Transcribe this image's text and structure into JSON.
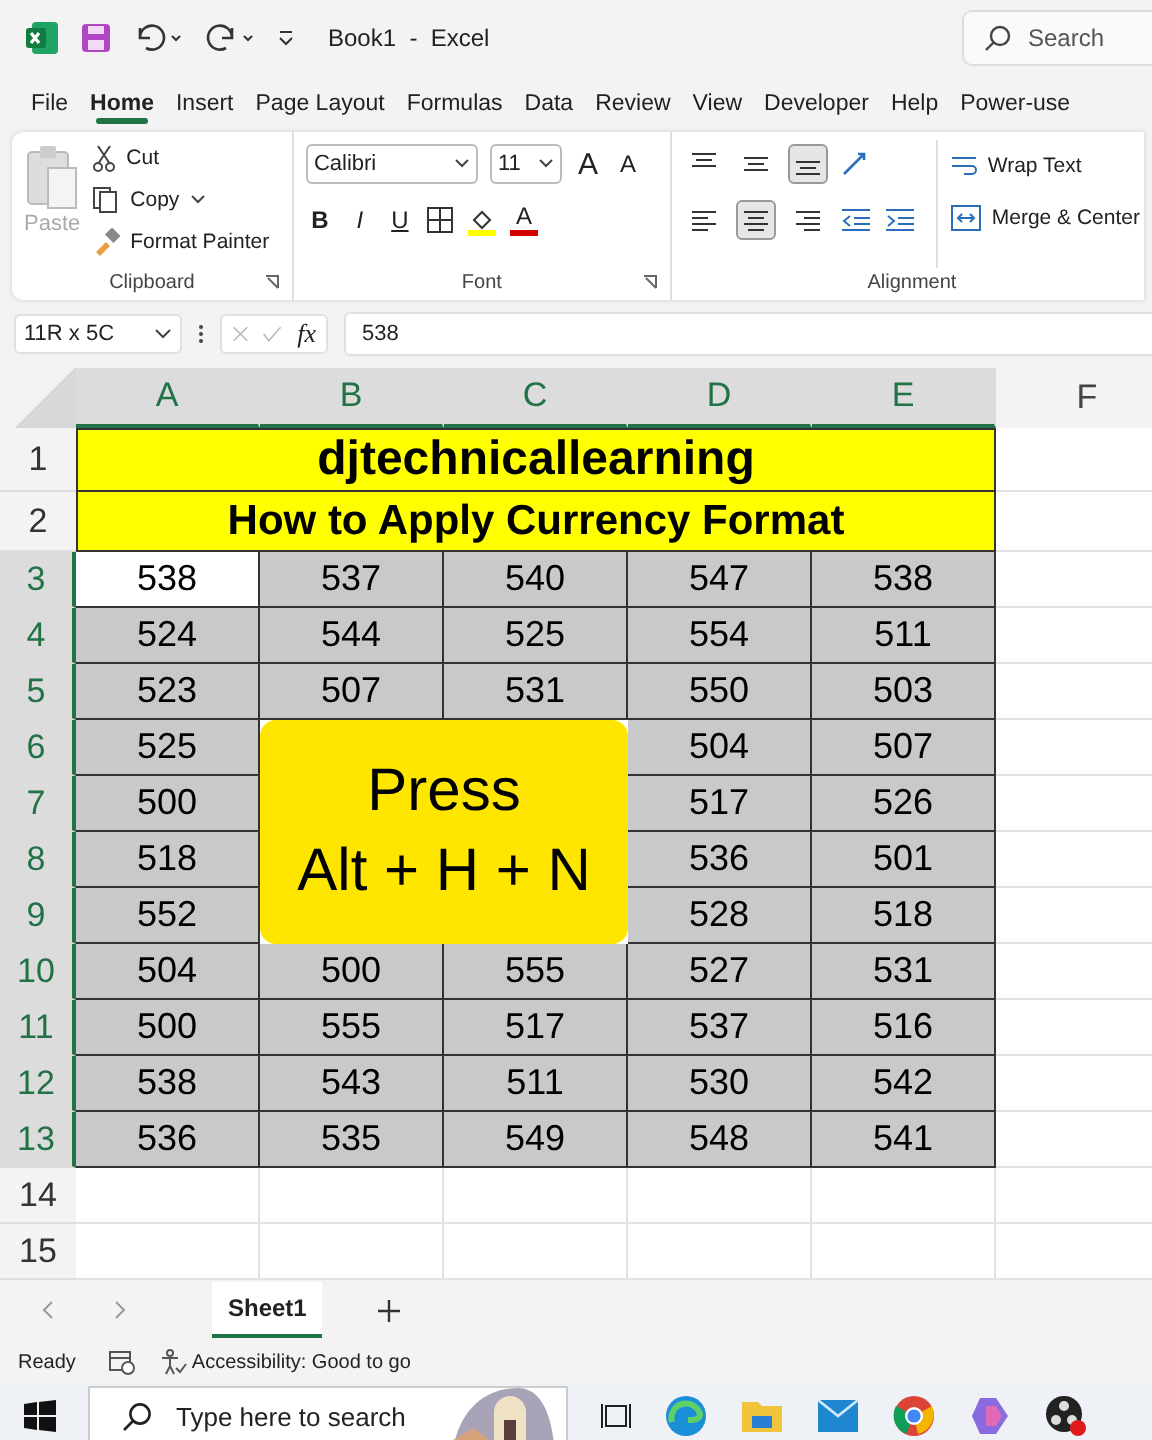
{
  "title_bar": {
    "title": "Book1  -  Excel",
    "search_placeholder": "Search"
  },
  "ribbon_tabs": [
    {
      "label": "File",
      "selected": false
    },
    {
      "label": "Home",
      "selected": true
    },
    {
      "label": "Insert",
      "selected": false
    },
    {
      "label": "Page Layout",
      "selected": false
    },
    {
      "label": "Formulas",
      "selected": false
    },
    {
      "label": "Data",
      "selected": false
    },
    {
      "label": "Review",
      "selected": false
    },
    {
      "label": "View",
      "selected": false
    },
    {
      "label": "Developer",
      "selected": false
    },
    {
      "label": "Help",
      "selected": false
    },
    {
      "label": "Power-use",
      "selected": false
    }
  ],
  "ribbon": {
    "clipboard": {
      "paste": "Paste",
      "paste_disabled": true,
      "cut": "Cut",
      "copy": "Copy",
      "format_painter": "Format Painter",
      "label": "Clipboard"
    },
    "font": {
      "font_name": "Calibri",
      "font_size": "11",
      "grow": "A",
      "shrink": "A",
      "bold": "B",
      "italic": "I",
      "underline": "U",
      "font_color": "A",
      "label": "Font"
    },
    "alignment": {
      "vertical": [
        {
          "selected": false
        },
        {
          "selected": false
        },
        {
          "selected": true
        }
      ],
      "horizontal": [
        {
          "selected": false
        },
        {
          "selected": true
        },
        {
          "selected": false
        }
      ],
      "wrap_text": "Wrap Text",
      "merge_center": "Merge & Center",
      "label": "Alignment"
    }
  },
  "formula_bar": {
    "name_box": "11R x 5C",
    "fx": "fx",
    "value": "538"
  },
  "sheet": {
    "columns": [
      {
        "label": "A",
        "selected": true
      },
      {
        "label": "B",
        "selected": true
      },
      {
        "label": "C",
        "selected": true
      },
      {
        "label": "D",
        "selected": true
      },
      {
        "label": "E",
        "selected": true
      },
      {
        "label": "F",
        "selected": false
      }
    ],
    "rows": [
      {
        "header": "1",
        "kind": "title",
        "selected": false,
        "text": "djtechnicallearning"
      },
      {
        "header": "2",
        "kind": "subtitle",
        "selected": false,
        "text": "How to Apply Currency Format"
      },
      {
        "header": "3",
        "kind": "data",
        "selected": true,
        "cells": [
          {
            "value": "538",
            "active": true
          },
          {
            "value": "537",
            "active": false
          },
          {
            "value": "540",
            "active": false
          },
          {
            "value": "547",
            "active": false
          },
          {
            "value": "538",
            "active": false
          }
        ]
      },
      {
        "header": "4",
        "kind": "data",
        "selected": true,
        "cells": [
          {
            "value": "524",
            "active": false
          },
          {
            "value": "544",
            "active": false
          },
          {
            "value": "525",
            "active": false
          },
          {
            "value": "554",
            "active": false
          },
          {
            "value": "511",
            "active": false
          }
        ]
      },
      {
        "header": "5",
        "kind": "data",
        "selected": true,
        "cells": [
          {
            "value": "523",
            "active": false
          },
          {
            "value": "507",
            "active": false
          },
          {
            "value": "531",
            "active": false
          },
          {
            "value": "550",
            "active": false
          },
          {
            "value": "503",
            "active": false
          }
        ]
      },
      {
        "header": "6",
        "kind": "data",
        "selected": true,
        "cells": [
          {
            "value": "525",
            "active": false
          },
          {},
          {},
          {
            "value": "504",
            "active": false
          },
          {
            "value": "507",
            "active": false
          }
        ]
      },
      {
        "header": "7",
        "kind": "data",
        "selected": true,
        "cells": [
          {
            "value": "500",
            "active": false
          },
          {},
          {},
          {
            "value": "517",
            "active": false
          },
          {
            "value": "526",
            "active": false
          }
        ]
      },
      {
        "header": "8",
        "kind": "data",
        "selected": true,
        "cells": [
          {
            "value": "518",
            "active": false
          },
          {},
          {},
          {
            "value": "536",
            "active": false
          },
          {
            "value": "501",
            "active": false
          }
        ]
      },
      {
        "header": "9",
        "kind": "data",
        "selected": true,
        "cells": [
          {
            "value": "552",
            "active": false
          },
          {},
          {},
          {
            "value": "528",
            "active": false
          },
          {
            "value": "518",
            "active": false
          }
        ]
      },
      {
        "header": "10",
        "kind": "data",
        "selected": true,
        "cells": [
          {
            "value": "504",
            "active": false
          },
          {
            "value": "500",
            "active": false
          },
          {
            "value": "555",
            "active": false
          },
          {
            "value": "527",
            "active": false
          },
          {
            "value": "531",
            "active": false
          }
        ]
      },
      {
        "header": "11",
        "kind": "data",
        "selected": true,
        "cells": [
          {
            "value": "500",
            "active": false
          },
          {
            "value": "555",
            "active": false
          },
          {
            "value": "517",
            "active": false
          },
          {
            "value": "537",
            "active": false
          },
          {
            "value": "516",
            "active": false
          }
        ]
      },
      {
        "header": "12",
        "kind": "data",
        "selected": true,
        "cells": [
          {
            "value": "538",
            "active": false
          },
          {
            "value": "543",
            "active": false
          },
          {
            "value": "511",
            "active": false
          },
          {
            "value": "530",
            "active": false
          },
          {
            "value": "542",
            "active": false
          }
        ]
      },
      {
        "header": "13",
        "kind": "data",
        "selected": true,
        "cells": [
          {
            "value": "536",
            "active": false
          },
          {
            "value": "535",
            "active": false
          },
          {
            "value": "549",
            "active": false
          },
          {
            "value": "548",
            "active": false
          },
          {
            "value": "541",
            "active": false
          }
        ]
      },
      {
        "header": "14",
        "kind": "empty",
        "selected": false
      },
      {
        "header": "15",
        "kind": "empty",
        "selected": false
      }
    ]
  },
  "overlay": {
    "lines": [
      "Press",
      "Alt + H + N"
    ]
  },
  "sheet_tabs": [
    {
      "label": "Sheet1",
      "selected": true
    }
  ],
  "status_bar": {
    "ready": "Ready",
    "accessibility": "Accessibility: Good to go"
  },
  "taskbar": {
    "search_placeholder": "Type here to search"
  }
}
